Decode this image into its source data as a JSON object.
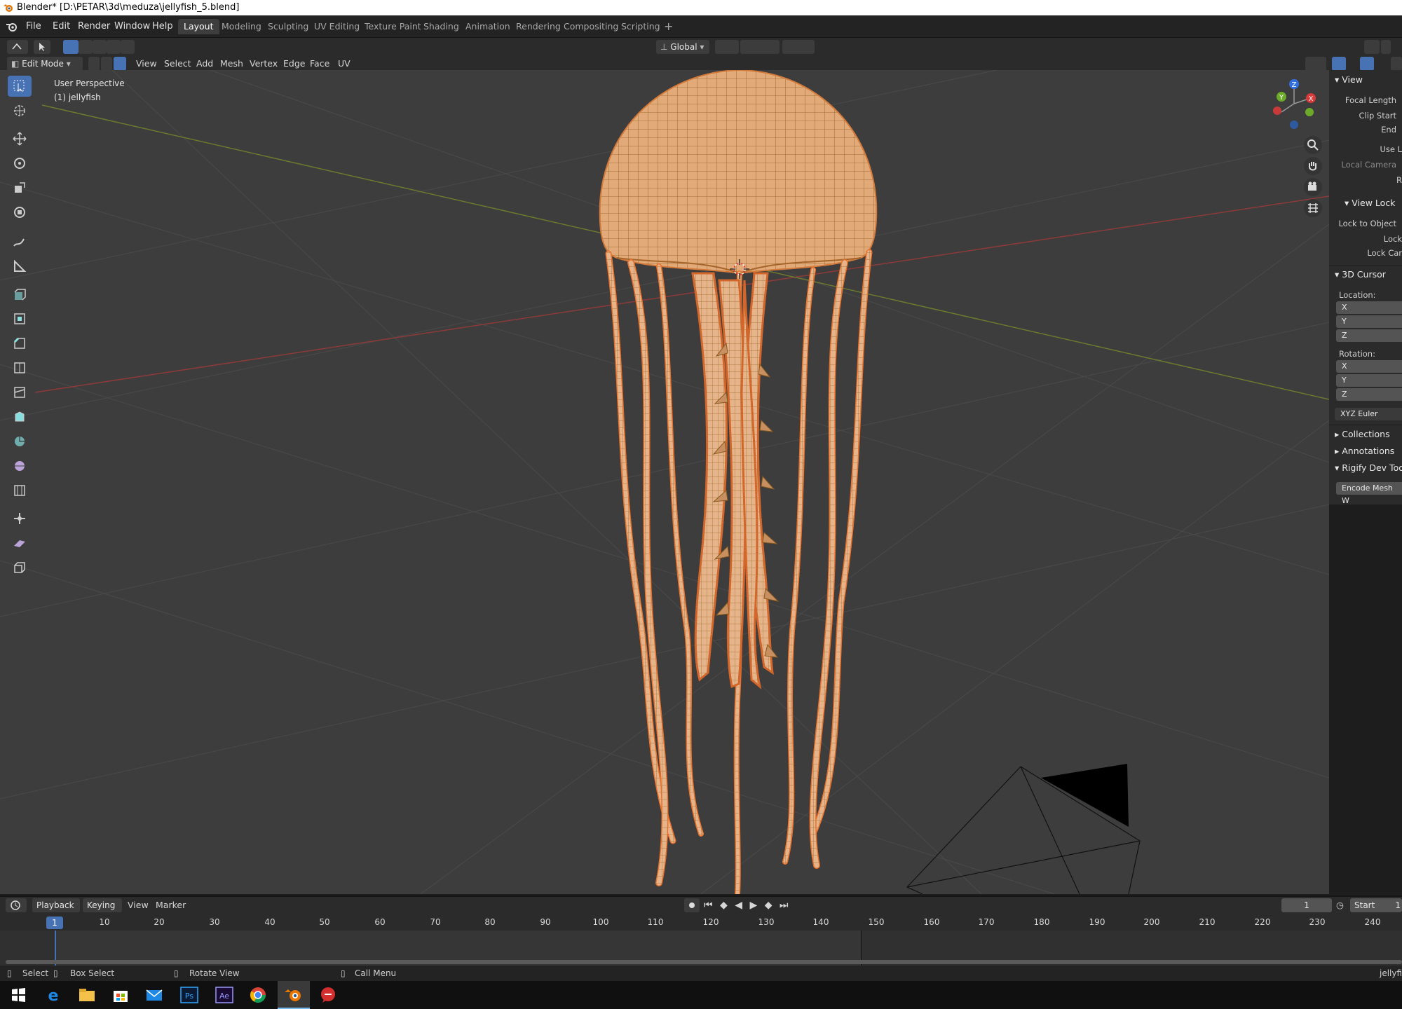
{
  "window": {
    "title": "Blender* [D:\\PETAR\\3d\\meduza\\jellyfish_5.blend]"
  },
  "menu": {
    "file": "File",
    "edit": "Edit",
    "render": "Render",
    "window": "Window",
    "help": "Help"
  },
  "workspaces": [
    "Layout",
    "Modeling",
    "Sculpting",
    "UV Editing",
    "Texture Paint",
    "Shading",
    "Animation",
    "Rendering",
    "Compositing",
    "Scripting"
  ],
  "header": {
    "transform_orientation": "Global",
    "mode": "Edit Mode",
    "menus": {
      "view": "View",
      "select": "Select",
      "add": "Add",
      "mesh": "Mesh",
      "vertex": "Vertex",
      "edge": "Edge",
      "face": "Face",
      "uv": "UV"
    }
  },
  "viewport": {
    "perspective": "User Perspective",
    "object": "(1) jellyfish",
    "gizmo": {
      "x": "X",
      "y": "Y",
      "z": "Z"
    }
  },
  "npanel": {
    "view_section": "View",
    "focal_length": "Focal Length",
    "clip_start": "Clip Start",
    "end": "End",
    "use_local": "Use L",
    "local_camera": "Local Camera",
    "r": "R",
    "view_lock_section": "View Lock",
    "lock_to_object": "Lock to Object",
    "lock": "Lock",
    "lock_cam": "Lock Car",
    "cursor_section": "3D Cursor",
    "location": "Location:",
    "rotation": "Rotation:",
    "x": "X",
    "y": "Y",
    "z": "Z",
    "rotation_mode": "XYZ Euler",
    "collections": "Collections",
    "annotations": "Annotations",
    "rigify": "Rigify Dev Too",
    "encode": "Encode Mesh W"
  },
  "timeline": {
    "playback": "Playback",
    "keying": "Keying",
    "view": "View",
    "marker": "Marker",
    "current_frame": "1",
    "start_label": "Start",
    "start_value": "1",
    "frame_marker": "1",
    "ticks": [
      "10",
      "20",
      "30",
      "40",
      "50",
      "60",
      "70",
      "80",
      "90",
      "100",
      "110",
      "120",
      "130",
      "140",
      "150",
      "160",
      "170",
      "180",
      "190",
      "200",
      "210",
      "220",
      "230",
      "240"
    ]
  },
  "status": {
    "select": "Select",
    "box_select": "Box Select",
    "rotate_view": "Rotate View",
    "call_menu": "Call Menu",
    "right": "jellyfis"
  },
  "colors": {
    "accent": "#4772b3",
    "mesh": "#e0a670",
    "edge_select": "#e8702a",
    "wire": "#8a5a1e"
  }
}
